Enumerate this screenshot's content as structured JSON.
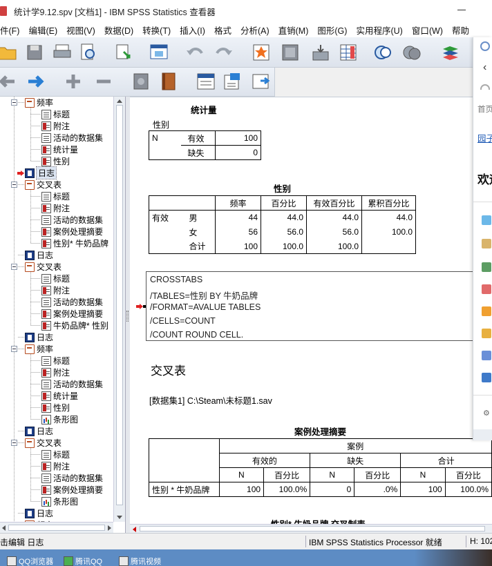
{
  "window": {
    "title": "统计学9.12.spv [文档1] - IBM SPSS Statistics 查看器"
  },
  "menu": [
    "件(F)",
    "编辑(E)",
    "视图(V)",
    "数据(D)",
    "转换(T)",
    "插入(I)",
    "格式",
    "分析(A)",
    "直销(M)",
    "图形(G)",
    "实用程序(U)",
    "窗口(W)",
    "帮助"
  ],
  "toolbar1_icons": [
    "open-folder-icon",
    "save-icon",
    "print-icon",
    "print-preview-icon",
    "export-icon",
    "recall-dialog-icon",
    "undo-icon",
    "redo-icon",
    "goto-data-icon",
    "goto-case-icon",
    "goto-variable-icon",
    "variables-icon",
    "select-cases-icon",
    "weight-cases-icon",
    "value-labels-icon"
  ],
  "toolbar2_icons": [
    "promote-icon",
    "demote-icon",
    "expand-icon",
    "collapse-icon",
    "show-icon",
    "hide-icon",
    "insert-heading-icon",
    "insert-title-icon",
    "insert-text-icon"
  ],
  "outline": [
    {
      "label": "频率",
      "icon": "book",
      "level": 1,
      "expander": true
    },
    {
      "label": "标题",
      "icon": "page",
      "level": 2
    },
    {
      "label": "附注",
      "icon": "table",
      "level": 2
    },
    {
      "label": "活动的数据集",
      "icon": "page",
      "level": 2
    },
    {
      "label": "统计量",
      "icon": "table",
      "level": 2
    },
    {
      "label": "性别",
      "icon": "table",
      "level": 2
    },
    {
      "label": "日志",
      "icon": "log",
      "level": 1,
      "selected": true,
      "arrow": true
    },
    {
      "label": "交叉表",
      "icon": "book",
      "level": 1,
      "expander": true
    },
    {
      "label": "标题",
      "icon": "page",
      "level": 2
    },
    {
      "label": "附注",
      "icon": "table",
      "level": 2
    },
    {
      "label": "活动的数据集",
      "icon": "page",
      "level": 2
    },
    {
      "label": "案例处理摘要",
      "icon": "table",
      "level": 2
    },
    {
      "label": "性别* 牛奶品牌",
      "icon": "table",
      "level": 2
    },
    {
      "label": "日志",
      "icon": "log",
      "level": 1
    },
    {
      "label": "交叉表",
      "icon": "book",
      "level": 1,
      "expander": true
    },
    {
      "label": "标题",
      "icon": "page",
      "level": 2
    },
    {
      "label": "附注",
      "icon": "table",
      "level": 2
    },
    {
      "label": "活动的数据集",
      "icon": "page",
      "level": 2
    },
    {
      "label": "案例处理摘要",
      "icon": "table",
      "level": 2
    },
    {
      "label": "牛奶品牌* 性别",
      "icon": "table",
      "level": 2
    },
    {
      "label": "日志",
      "icon": "log",
      "level": 1
    },
    {
      "label": "频率",
      "icon": "book",
      "level": 1,
      "expander": true
    },
    {
      "label": "标题",
      "icon": "page",
      "level": 2
    },
    {
      "label": "附注",
      "icon": "table",
      "level": 2
    },
    {
      "label": "活动的数据集",
      "icon": "page",
      "level": 2
    },
    {
      "label": "统计量",
      "icon": "table",
      "level": 2
    },
    {
      "label": "性别",
      "icon": "table",
      "level": 2
    },
    {
      "label": "条形图",
      "icon": "chart",
      "level": 2
    },
    {
      "label": "日志",
      "icon": "log",
      "level": 1
    },
    {
      "label": "交叉表",
      "icon": "book",
      "level": 1,
      "expander": true
    },
    {
      "label": "标题",
      "icon": "page",
      "level": 2
    },
    {
      "label": "附注",
      "icon": "table",
      "level": 2
    },
    {
      "label": "活动的数据集",
      "icon": "page",
      "level": 2
    },
    {
      "label": "案例处理摘要",
      "icon": "table",
      "level": 2
    },
    {
      "label": "条形图",
      "icon": "chart",
      "level": 2
    },
    {
      "label": "日志",
      "icon": "log",
      "level": 1
    },
    {
      "label": "频率",
      "icon": "book",
      "level": 1,
      "expander": true
    }
  ],
  "stats_table": {
    "title": "统计量",
    "var_label": "性别",
    "n_label": "N",
    "rows": [
      {
        "label": "有效",
        "value": "100"
      },
      {
        "label": "缺失",
        "value": "0"
      }
    ]
  },
  "freq_table": {
    "title": "性别",
    "headers": [
      "",
      "",
      "频率",
      "百分比",
      "有效百分比",
      "累积百分比"
    ],
    "group_label": "有效",
    "rows": [
      {
        "label": "男",
        "freq": "44",
        "pct": "44.0",
        "valid_pct": "44.0",
        "cum_pct": "44.0"
      },
      {
        "label": "女",
        "freq": "56",
        "pct": "56.0",
        "valid_pct": "56.0",
        "cum_pct": "100.0"
      },
      {
        "label": "合计",
        "freq": "100",
        "pct": "100.0",
        "valid_pct": "100.0",
        "cum_pct": ""
      }
    ]
  },
  "syntax": [
    "CROSSTABS",
    "  /TABLES=性别 BY 牛奶品牌",
    "  /FORMAT=AVALUE TABLES",
    "  /CELLS=COUNT",
    "  /COUNT ROUND CELL."
  ],
  "section": {
    "heading": "交叉表",
    "dataset": "[数据集1] C:\\Steam\\未标题1.sav"
  },
  "case_table": {
    "title": "案例处理摘要",
    "top_header": "案例",
    "groups": [
      "有效的",
      "缺失",
      "合计"
    ],
    "subheaders": [
      "N",
      "百分比",
      "N",
      "百分比",
      "N",
      "百分比"
    ],
    "row_label": "性别 * 牛奶品牌",
    "values": [
      "100",
      "100.0%",
      "0",
      ".0%",
      "100",
      "100.0%"
    ]
  },
  "next_title": "性别* 牛奶品牌 交叉制表",
  "status": {
    "left": "击编辑 日志",
    "processor": "IBM SPSS Statistics Processor 就绪",
    "right": "H: 102"
  },
  "taskbar": [
    "QQ浏览器",
    "腾讯QQ",
    "腾讯视频"
  ],
  "side_panel": {
    "items": [
      "首页",
      "园子",
      "欢迎"
    ]
  },
  "colors": {
    "selection": "#dde6f3",
    "marker_red": "#e02020",
    "taskbar": "#5d8cc4",
    "toolbar_top": "#eef2f8"
  }
}
